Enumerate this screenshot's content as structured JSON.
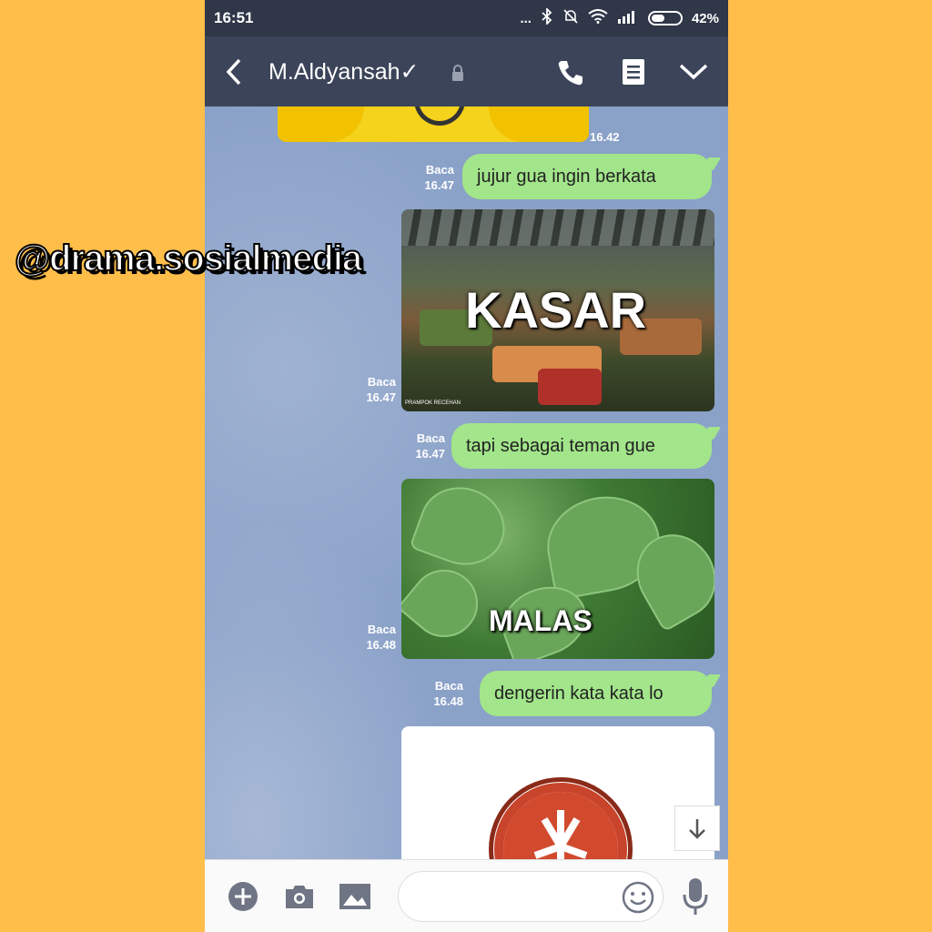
{
  "status": {
    "time": "16:51",
    "dots": "...",
    "battery": "42%"
  },
  "header": {
    "contact_name": "M.Aldyansah✓"
  },
  "colors": {
    "header": "#3B4459",
    "statusbar": "#2F3748",
    "chat_bg": "#8AA1C8",
    "bubble": "#A2E58A",
    "background": "#FFBE4A"
  },
  "messages": [
    {
      "time": "16.42"
    },
    {
      "status": "Baca",
      "time": "16.47",
      "text": "jujur gua ingin berkata"
    },
    {
      "status": "Baca",
      "time": "16.47",
      "image_text": "KASAR",
      "image_caption": "PRAMPOK RECEHAN"
    },
    {
      "status": "Baca",
      "time": "16.47",
      "text": "tapi sebagai teman gue"
    },
    {
      "status": "Baca",
      "time": "16.48",
      "image_text": "MALAS"
    },
    {
      "status": "Baca",
      "time": "16.48",
      "text": "dengerin kata kata lo"
    }
  ],
  "watermark": "@drama.sosialmedia",
  "icons": [
    "back-arrow-icon",
    "lock-icon",
    "phone-icon",
    "notes-icon",
    "chevron-down-icon",
    "scroll-down-icon",
    "plus-icon",
    "camera-icon",
    "image-icon",
    "emoji-icon",
    "microphone-icon"
  ]
}
